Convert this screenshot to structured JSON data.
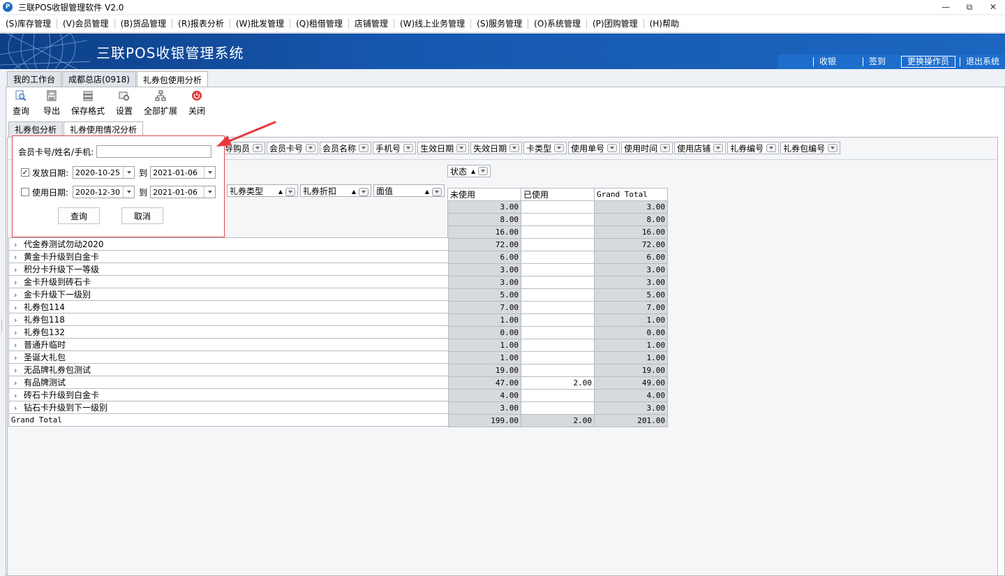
{
  "window": {
    "title": "三联POS收银管理软件 V2.0",
    "app_icon_letter": "P"
  },
  "menu": [
    "(S)库存管理",
    "(V)会员管理",
    "(B)货品管理",
    "(R)报表分析",
    "(W)批发管理",
    "(Q)租借管理",
    "店铺管理",
    "(W)线上业务管理",
    "(S)服务管理",
    "(O)系统管理",
    "(P)团购管理",
    "(H)帮助"
  ],
  "banner": {
    "title": "三联POS收银管理系统",
    "links": [
      "收银",
      "签到",
      "更换操作员",
      "退出系统"
    ]
  },
  "main_tabs": [
    "我的工作台",
    "成都总店(0918)",
    "礼券包使用分析"
  ],
  "toolbar": [
    "查询",
    "导出",
    "保存格式",
    "设置",
    "全部扩展",
    "关闭"
  ],
  "sub_tabs": [
    "礼券包分析",
    "礼券使用情况分析"
  ],
  "filter_fields": [
    "导购员",
    "会员卡号",
    "会员名称",
    "手机号",
    "生效日期",
    "失效日期",
    "卡类型",
    "使用单号",
    "使用时间",
    "使用店铺",
    "礼券编号",
    "礼券包编号"
  ],
  "column_field": "状态",
  "row_fields": [
    "礼券类型",
    "礼券折扣",
    "面值"
  ],
  "columns": [
    "未使用",
    "已使用",
    "Grand Total"
  ],
  "rows": [
    {
      "label": "",
      "unused": "3.00",
      "used": "",
      "total": "3.00"
    },
    {
      "label": "",
      "unused": "8.00",
      "used": "",
      "total": "8.00"
    },
    {
      "label": "",
      "unused": "16.00",
      "used": "",
      "total": "16.00"
    },
    {
      "label": "代金券测试勿动2020",
      "unused": "72.00",
      "used": "",
      "total": "72.00"
    },
    {
      "label": "黄金卡升级到白金卡",
      "unused": "6.00",
      "used": "",
      "total": "6.00"
    },
    {
      "label": "积分卡升级下一等级",
      "unused": "3.00",
      "used": "",
      "total": "3.00"
    },
    {
      "label": "金卡升级到砖石卡",
      "unused": "3.00",
      "used": "",
      "total": "3.00"
    },
    {
      "label": "金卡升级下一级别",
      "unused": "5.00",
      "used": "",
      "total": "5.00"
    },
    {
      "label": "礼券包114",
      "unused": "7.00",
      "used": "",
      "total": "7.00"
    },
    {
      "label": "礼券包118",
      "unused": "1.00",
      "used": "",
      "total": "1.00"
    },
    {
      "label": "礼券包132",
      "unused": "0.00",
      "used": "",
      "total": "0.00"
    },
    {
      "label": "普通升临时",
      "unused": "1.00",
      "used": "",
      "total": "1.00"
    },
    {
      "label": "圣诞大礼包",
      "unused": "1.00",
      "used": "",
      "total": "1.00"
    },
    {
      "label": "无品牌礼券包测试",
      "unused": "19.00",
      "used": "",
      "total": "19.00"
    },
    {
      "label": "有品牌测试",
      "unused": "47.00",
      "used": "2.00",
      "total": "49.00"
    },
    {
      "label": "砖石卡升级到白金卡",
      "unused": "4.00",
      "used": "",
      "total": "4.00"
    },
    {
      "label": "钻石卡升级到下一级别",
      "unused": "3.00",
      "used": "",
      "total": "3.00"
    }
  ],
  "grand_total": {
    "label": "Grand Total",
    "unused": "199.00",
    "used": "2.00",
    "total": "201.00"
  },
  "popup": {
    "member_label": "会员卡号/姓名/手机:",
    "member_value": "",
    "issue_label": "发放日期:",
    "issue_checked": true,
    "issue_from": "2020-10-25",
    "issue_to": "2021-01-06",
    "use_label": "使用日期:",
    "use_checked": false,
    "use_from": "2020-12-30",
    "use_to": "2021-01-06",
    "to_label": "到",
    "query_button": "查询",
    "cancel_button": "取消"
  },
  "colors": {
    "banner": "#1658b0",
    "popup_border": "#e0474c",
    "annotation_arrow": "#e8373c"
  }
}
